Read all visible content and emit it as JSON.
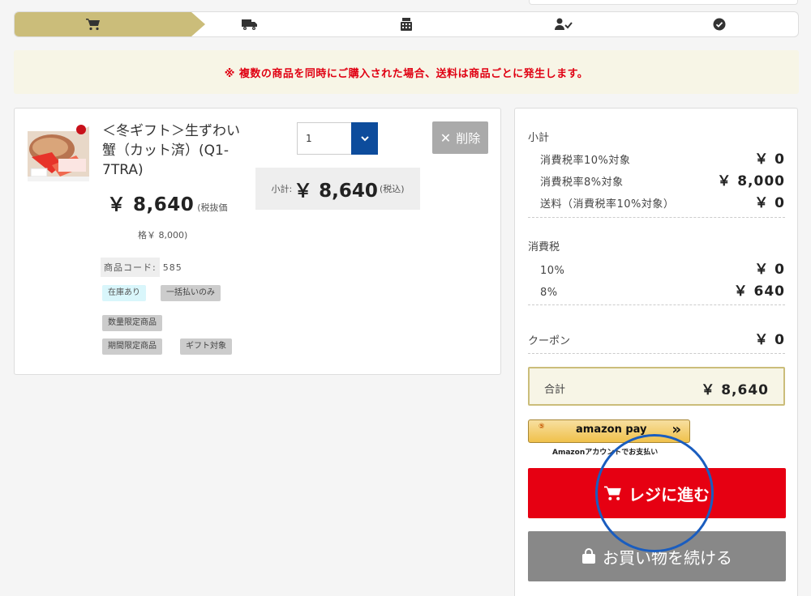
{
  "steps": {
    "icons": [
      "cart-icon",
      "truck-icon",
      "register-icon",
      "user-check-icon",
      "check-circle-icon"
    ],
    "active_color": "#cbbd7a"
  },
  "notice": {
    "text": "※ 複数の商品を同時にご購入された場合、送料は商品ごとに発生します。",
    "color": "#e00012"
  },
  "item": {
    "name": "＜冬ギフト＞生ずわい蟹（カット済）(Q1-7TRA)",
    "price": "￥ 8,640",
    "price_note_1": "(税抜価",
    "price_note_2": "格￥ 8,000)",
    "code_label": "商品コード:",
    "code_value": "585",
    "tags": [
      "在庫あり",
      "一括払いのみ",
      "数量限定商品",
      "期間限定商品",
      "ギフト対象"
    ],
    "quantity": "1",
    "subtotal_label": "小計:",
    "subtotal_value": "￥ 8,640",
    "subtotal_tax": "(税込)",
    "delete_label": "削除"
  },
  "summary": {
    "subtotal_label": "小計",
    "rows_subtotal": [
      {
        "label": "消費税率10%対象",
        "value": "￥ 0"
      },
      {
        "label": "消費税率8%対象",
        "value": "￥ 8,000"
      },
      {
        "label": "送料（消費税率10%対象）",
        "value": "￥ 0"
      }
    ],
    "tax_label": "消費税",
    "rows_tax": [
      {
        "label": "10%",
        "value": "￥ 0"
      },
      {
        "label": "8%",
        "value": "￥ 640"
      }
    ],
    "coupon_label": "クーポン",
    "coupon_value": "￥ 0",
    "total_label": "合計",
    "total_value": "￥ 8,640"
  },
  "amazon_pay": {
    "label": "amazon pay",
    "arrows": "»",
    "coin": "⑤",
    "note": "Amazonアカウントでお支払い"
  },
  "buttons": {
    "checkout": "レジに進む",
    "continue": "お買い物を続ける"
  },
  "colors": {
    "checkout": "#e60012",
    "continue": "#888888",
    "accent": "#0d4c9c"
  }
}
